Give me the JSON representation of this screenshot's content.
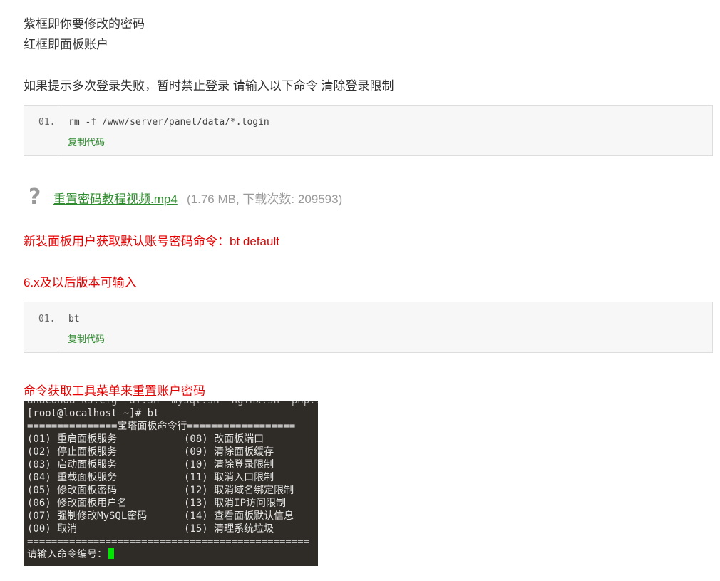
{
  "intro": {
    "line1": "紫框即你要修改的密码",
    "line2": "红框即面板账户",
    "line3": "如果提示多次登录失败，暂时禁止登录 请输入以下命令 清除登录限制"
  },
  "code_block_1": {
    "line_number": "01.",
    "code": "rm -f /www/server/panel/data/*.login",
    "copy_label": "复制代码"
  },
  "attachment": {
    "icon": "question-mark-icon",
    "file_name": "重置密码教程视频.mp4",
    "meta": "(1.76 MB, 下载次数: 209593)"
  },
  "new_panel_note": "新装面板用户获取默认账号密码命令：bt default",
  "version_note": "6.x及以后版本可输入",
  "code_block_2": {
    "line_number": "01.",
    "code": "bt",
    "copy_label": "复制代码"
  },
  "terminal_note": "命令获取工具菜单来重置账户密码",
  "terminal": {
    "cut_line": "anaconda-ks.cfg  di.sh  mysql.sh  nginx.sh  php.sh  p",
    "prompt_line": "[root@localhost ~]# bt",
    "header_line": "===============宝塔面板命令行==================",
    "rows": [
      {
        "left": "(01) 重启面板服务",
        "right": "(08) 改面板端口"
      },
      {
        "left": "(02) 停止面板服务",
        "right": "(09) 清除面板缓存"
      },
      {
        "left": "(03) 启动面板服务",
        "right": "(10) 清除登录限制"
      },
      {
        "left": "(04) 重载面板服务",
        "right": "(11) 取消入口限制"
      },
      {
        "left": "(05) 修改面板密码",
        "right": "(12) 取消域名绑定限制"
      },
      {
        "left": "(06) 修改面板用户名",
        "right": "(13) 取消IP访问限制"
      },
      {
        "left": "(07) 强制修改MySQL密码",
        "right": "(14) 查看面板默认信息"
      },
      {
        "left": "(00) 取消",
        "right": "(15) 清理系统垃圾"
      }
    ],
    "footer_line": "===============================================",
    "input_prompt": "请输入命令编号："
  }
}
